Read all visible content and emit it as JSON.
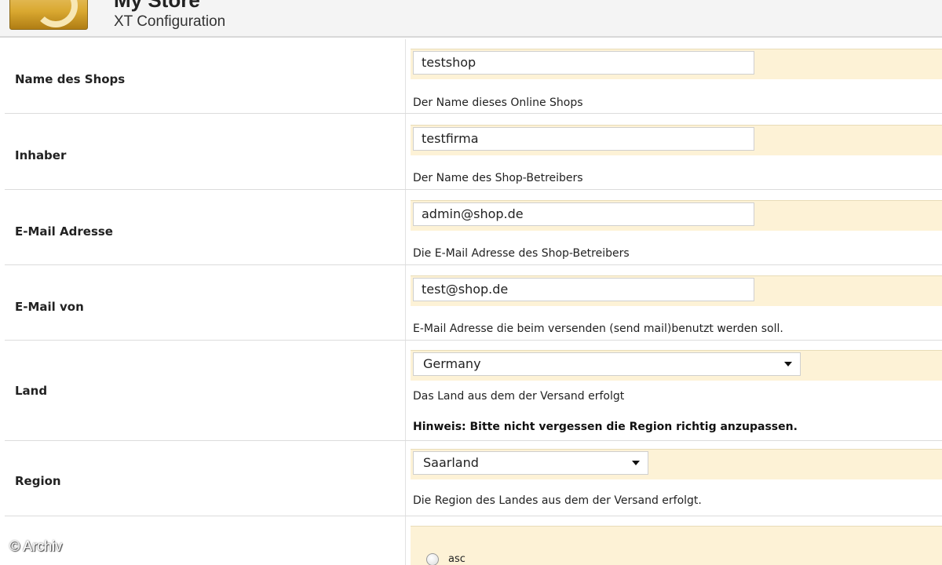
{
  "header": {
    "title": "My Store",
    "subtitle": "XT Configuration",
    "logo_icon": "store-logo-icon"
  },
  "fields": {
    "shop_name": {
      "label": "Name des Shops",
      "value": "testshop",
      "description": "Der Name dieses Online Shops"
    },
    "owner": {
      "label": "Inhaber",
      "value": "testfirma",
      "description": "Der Name des Shop-Betreibers"
    },
    "email_address": {
      "label": "E-Mail Adresse",
      "value": "admin@shop.de",
      "description": "Die E-Mail Adresse des Shop-Betreibers"
    },
    "email_from": {
      "label": "E-Mail von",
      "value": "test@shop.de",
      "description": "E-Mail Adresse die beim versenden (send mail)benutzt werden soll."
    },
    "country": {
      "label": "Land",
      "selected": "Germany",
      "description": "Das Land aus dem der Versand erfolgt",
      "hint": "Hinweis: Bitte nicht vergessen die Region richtig anzupassen."
    },
    "region": {
      "label": "Region",
      "selected": "Saarland",
      "description": "Die Region des Landes aus dem der Versand erfolgt."
    },
    "sort_order": {
      "option_label": "asc"
    }
  },
  "watermark": "© Archiv",
  "colors": {
    "field_background": "#fdf2d6",
    "header_background": "#f4f4f4",
    "logo_accent": "#d9a830"
  }
}
